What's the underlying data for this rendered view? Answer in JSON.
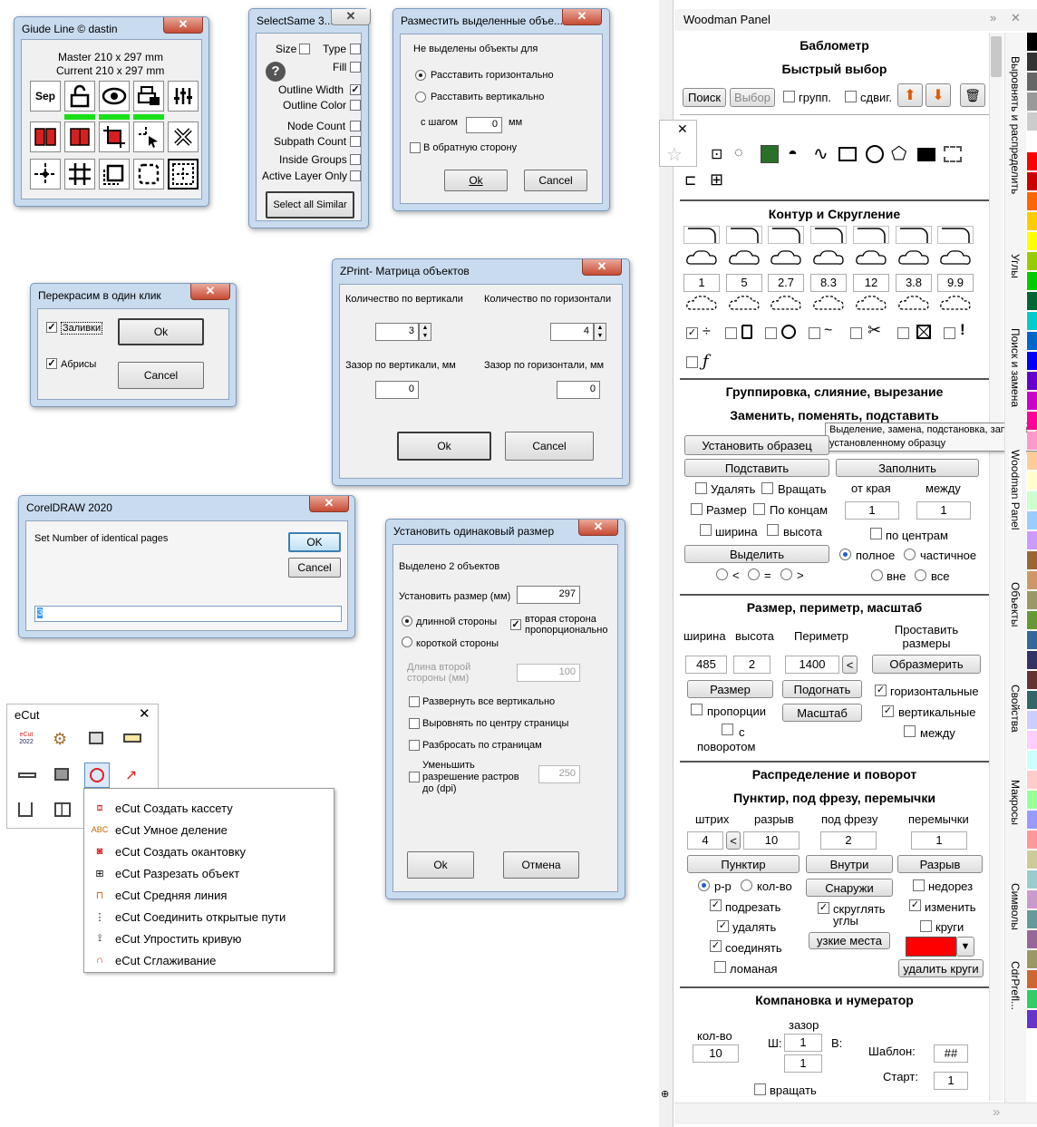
{
  "guideline": {
    "title": "Giude Line © dastin",
    "close": "✕",
    "master": "Master 210 x 297 mm",
    "current": "Current 210 x 297 mm",
    "sep": "Sep"
  },
  "selectsame": {
    "title": "SelectSame 3...",
    "close": "✕",
    "size": "Size",
    "type": "Type",
    "fill": "Fill",
    "outline_width": "Outline Width",
    "outline_color": "Outline Color",
    "node_count": "Node Count",
    "subpath_count": "Subpath Count",
    "inside_groups": "Inside Groups",
    "active_layer": "Active Layer Only",
    "select_all": "Select all Similar"
  },
  "razmestit": {
    "title": "Разместить выделенные объе...",
    "close": "✕",
    "none_selected": "Не выделены объекты для",
    "horiz": "Расставить горизонтально",
    "vert": "Расставить вертикально",
    "step": "с шагом",
    "step_value": "0",
    "mm": "мм",
    "reverse": "В обратную сторону",
    "ok": "Ok",
    "cancel": "Cancel"
  },
  "perekrasim": {
    "title": "Перекрасим в один клик",
    "close": "✕",
    "fills": "Заливки",
    "outlines": "Абрисы",
    "ok": "Ok",
    "cancel": "Cancel"
  },
  "zprint": {
    "title": "ZPrint- Матрица объектов",
    "close": "✕",
    "vert_count": "Количество по вертикали",
    "horiz_count": "Количество по горизонтали",
    "vert_value": "3",
    "horiz_value": "4",
    "vert_gap": "Зазор по вертикали, мм",
    "horiz_gap": "Зазор по горизонтали, мм",
    "vgap_value": "0",
    "hgap_value": "0",
    "ok": "Ok",
    "cancel": "Cancel"
  },
  "coreldraw": {
    "title": "CorelDRAW 2020",
    "close": "✕",
    "prompt": "Set Number of identical pages",
    "ok": "OK",
    "cancel": "Cancel",
    "value": "3"
  },
  "ustanovit": {
    "title": "Установить одинаковый размер",
    "close": "✕",
    "selected": "Выделено 2 объектов",
    "set_size": "Установить размер (мм)",
    "size_value": "297",
    "long_side": "длинной стороны",
    "short_side": "короткой стороны",
    "second_prop": "вторая сторона пропорционально",
    "second_len": "Длина второй стороны (мм)",
    "second_value": "100",
    "rotate_vert": "Развернуть все вертикально",
    "align_center": "Выровнять по центру страницы",
    "scatter": "Разбросать по страницам",
    "reduce": "Уменьшить разрешение растров до (dpi)",
    "dpi_value": "250",
    "ok": "Ok",
    "cancel": "Отмена"
  },
  "ecut": {
    "title": "eCut",
    "close": "✕",
    "menu": [
      {
        "icon": "cassette-icon",
        "label": "eCut Создать кассету"
      },
      {
        "icon": "smart-divide-icon",
        "label": "eCut Умное деление"
      },
      {
        "icon": "edging-icon",
        "label": "eCut Создать окантовку"
      },
      {
        "icon": "cut-object-icon",
        "label": "eCut Разрезать объект"
      },
      {
        "icon": "middle-line-icon",
        "label": "eCut Средняя линия"
      },
      {
        "icon": "join-paths-icon",
        "label": "eCut Соединить открытые пути"
      },
      {
        "icon": "simplify-curve-icon",
        "label": "eCut Упростить кривую"
      },
      {
        "icon": "smoothing-icon",
        "label": "eCut Сглаживание"
      }
    ]
  },
  "woodman": {
    "title": "Woodman Panel",
    "bablometr": "Баблометр",
    "quick_select": "Быстрый выбор",
    "search": "Поиск",
    "select": "Выбор",
    "group": "групп.",
    "shift": "сдвиг.",
    "contour_title": "Контур и Скругление",
    "radii": [
      "1",
      "5",
      "2.7",
      "8.3",
      "12",
      "3.8",
      "9.9"
    ],
    "grouping_title": "Группировка, слияние, вырезание",
    "replace_title": "Заменить, поменять, подставить",
    "tooltip_line1": "Выделение, замена, подстановка, заполне",
    "tooltip_line2": "установленному образцу",
    "set_sample": "Установить образец",
    "substitute": "Подставить",
    "fill": "Заполнить",
    "delete": "Удалять",
    "rotate": "Вращать",
    "from_edge": "от края",
    "between": "между",
    "from_edge_value": "1",
    "between_value": "1",
    "size": "Размер",
    "at_ends": "По концам",
    "width": "ширина",
    "height": "высота",
    "by_centers": "по центрам",
    "select_btn": "Выделить",
    "full": "полное",
    "partial": "частичное",
    "lt": "<",
    "eq": "=",
    "gt": ">",
    "outside": "вне",
    "all": "все",
    "size_title": "Размер, периметр, масштаб",
    "w_label": "ширина",
    "h_label": "высота",
    "perimeter": "Периметр",
    "set_dims": "Проставить размеры",
    "w_value": "485",
    "h_value": "2",
    "perim_value": "1400",
    "lt_btn": "<",
    "dimension": "Образмерить",
    "size_btn": "Размер",
    "fit": "Подогнать",
    "horizontal": "горизонтальные",
    "proportions": "пропорции",
    "scale": "Масштаб",
    "vertical": "вертикальные",
    "with_rotation": "с поворотом",
    "between2": "между",
    "distrib_title": "Распределение и поворот",
    "dash_title": "Пунктир, под фрезу, перемычки",
    "stroke": "штрих",
    "gap": "разрыв",
    "for_mill": "под фрезу",
    "jumpers": "перемычки",
    "stroke_value": "4",
    "gap_value": "10",
    "mill_value": "2",
    "jumpers_value": "1",
    "dash_btn": "Пунктир",
    "inside": "Внутри",
    "break": "Разрыв",
    "pp": "р-р",
    "count": "кол-во",
    "outside_btn": "Снаружи",
    "undercut": "недорез",
    "trim": "подрезать",
    "round_corners": "скруглять углы",
    "change": "изменить",
    "delete2": "удалять",
    "narrow": "узкие места",
    "circles": "круги",
    "join": "соединять",
    "broken": "ломаная",
    "delete_circles": "удалить круги",
    "layout_title": "Компановка и нумератор",
    "gap2": "зазор",
    "qty": "кол-во",
    "sh": "Ш:",
    "v": "В:",
    "qty_value": "10",
    "sh_value": "1",
    "v_value": "1",
    "template": "Шаблон:",
    "template_value": "##",
    "start": "Старт:",
    "start_value": "1",
    "rotate2": "вращать",
    "tabs": [
      "Выровнять и распределить",
      "Углы",
      "Поиск и замена",
      "Woodman Panel",
      "Объекты",
      "Свойства",
      "Макросы",
      "Символы",
      "CdrPrefl..."
    ],
    "color_red": "#ff0000"
  }
}
